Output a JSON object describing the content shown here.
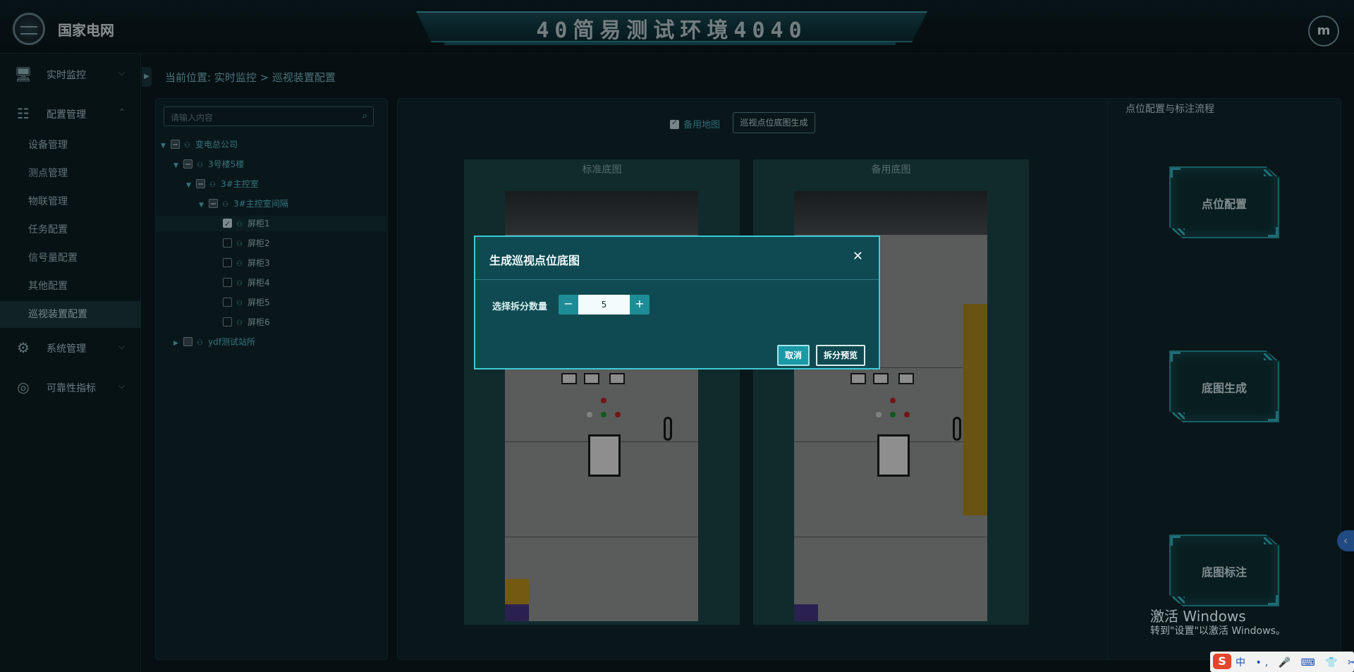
{
  "header": {
    "brand": "国家电网",
    "title": "40简易测试环境4040",
    "avatar": "m"
  },
  "sidebar": {
    "groups": [
      {
        "label": "实时监控",
        "icon": "monitor-icon"
      },
      {
        "label": "配置管理",
        "icon": "sliders-icon"
      },
      {
        "label": "系统管理",
        "icon": "gear-icon"
      },
      {
        "label": "可靠性指标",
        "icon": "target-icon"
      }
    ],
    "sub_items": [
      "设备管理",
      "测点管理",
      "物联管理",
      "任务配置",
      "信号量配置",
      "其他配置",
      "巡视装置配置"
    ]
  },
  "breadcrumb": "当前位置: 实时监控 > 巡视装置配置",
  "tree": {
    "search_placeholder": "请输入内容",
    "nodes": [
      {
        "label": "变电总公司"
      },
      {
        "label": "3号楼5楼"
      },
      {
        "label": "3#主控室"
      },
      {
        "label": "3#主控室间隔"
      },
      {
        "label": "屏柜1"
      },
      {
        "label": "屏柜2"
      },
      {
        "label": "屏柜3"
      },
      {
        "label": "屏柜4"
      },
      {
        "label": "屏柜5"
      },
      {
        "label": "屏柜6"
      },
      {
        "label": "ydf测试站所"
      }
    ]
  },
  "center": {
    "backup_map_label": "备用地图",
    "generate_button": "巡视点位底图生成",
    "standard_map_title": "标准底图",
    "backup_map_title": "备用底图"
  },
  "right_panel": {
    "title": "点位配置与标注流程",
    "steps": [
      "点位配置",
      "底图生成",
      "底图标注"
    ]
  },
  "modal": {
    "title": "生成巡视点位底图",
    "field_label": "选择拆分数量",
    "value": "5",
    "minus": "−",
    "plus": "+",
    "cancel": "取消",
    "preview": "拆分预览"
  },
  "watermark": {
    "line1": "激活 Windows",
    "line2": "转到\"设置\"以激活 Windows。"
  },
  "ime": {
    "logo": "S",
    "items": "中 •, 🎤 ⌨ 👕 ✂"
  }
}
